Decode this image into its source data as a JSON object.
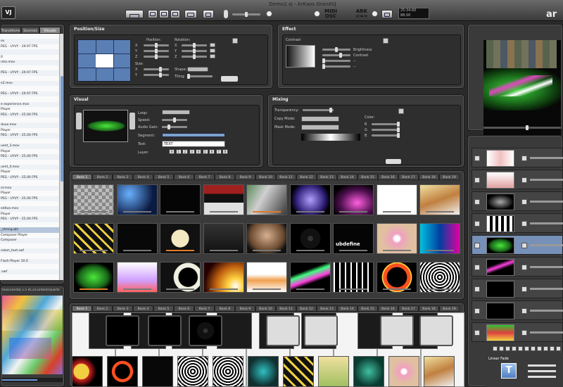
{
  "window": {
    "title": "Demo2.xj - ArKaos GrandVJ",
    "logo": "VJ",
    "brand_right": "ar"
  },
  "toolbar": {
    "midi_osc_line1": "MIDI",
    "midi_osc_line2": "OSC",
    "ark_line1": "ARK",
    "ark_line2": "<=>",
    "time_line1": "25:34:60",
    "time_line2": "88.00"
  },
  "left_tabs": [
    "Transitions",
    "Sources",
    "Visuals"
  ],
  "file_list": [
    "",
    "ov",
    "PEG - UYVY - 29.97 FPS",
    "",
    "0",
    "ntro.mov",
    "",
    "PEG - UYVY - 29.97 FPS",
    "",
    "e2.mov",
    "",
    "PEG - UYVY - 29.97 FPS",
    "",
    "e experience.mov",
    "Player",
    "PEG - UYVY - 25.00 FPS",
    "",
    "duuo.mov",
    "Player",
    "PEG - UYVY - 25.00 FPS",
    "",
    "uent_3.mov",
    "Player",
    "PEG - UYVY - 25.00 FPS",
    "",
    "uent_4.mov",
    "Player",
    "PEG - UYVY - 25.00 FPS",
    "",
    "ol.mov",
    "Player",
    "PEG - UYVY - 25.00 FPS",
    "",
    "ed4ue.mov",
    "Player",
    "PEG - UYVY - 25.00 FPS",
    "",
    "_strong.qtz",
    "Composer Player",
    "Composer",
    "",
    "ndom_text.swf",
    "",
    "Flash Player 10.0",
    "",
    ".swf",
    "",
    "Flash Player 10.0",
    ""
  ],
  "file_selected_index": 37,
  "source_path": "tos/GrandVJ 1.5 RC1/Content/Quartz",
  "position_panel": {
    "title": "Position/Size",
    "position": "Position:",
    "rotation": "Rotation:",
    "size": "Size:",
    "shape": "Shape:",
    "tiling": "Tiling:",
    "x": "X",
    "y": "Y",
    "z": "Z"
  },
  "effect_panel": {
    "title": "Effect",
    "contrast_title": "Contrast",
    "brightness": "Brightness",
    "contrast": "Contrast",
    "dash1": "--",
    "dash2": "--"
  },
  "visual_panel": {
    "title": "Visual",
    "loop": "Loop:",
    "speed": "Speed:",
    "audio_gain": "Audio Gain:",
    "segment": "Segment:",
    "text": "Text:",
    "layer": "Layer:",
    "text_value": "TEXT",
    "layers": [
      "0",
      "1",
      "2",
      "3",
      "4",
      "5",
      "6",
      "7",
      "8"
    ]
  },
  "mixing_panel": {
    "title": "Mixing",
    "transparency": "Transparency:",
    "copy_mode": "Copy Mode:",
    "mask_mode": "Mask Mode:",
    "color": "Color:",
    "r": "R",
    "g": "G",
    "b": "B"
  },
  "bank_top": {
    "tabs": [
      "Bank 1",
      "Bank 2",
      "Bank 3",
      "Bank 4",
      "Bank 5",
      "Bank 6",
      "Bank 7",
      "Bank 8",
      "Bank 9",
      "Bank 10",
      "Bank 11",
      "Bank 12",
      "Bank 13",
      "Bank 14",
      "Bank 15",
      "Bank 16",
      "Bank 17",
      "Bank 18",
      "Bank 19"
    ],
    "active": 0,
    "grid_text": "ubdefine"
  },
  "bank_bottom": {
    "tabs": [
      "Bank 1",
      "Bank 2",
      "Bank 3",
      "Bank 4",
      "Bank 5",
      "Bank 6",
      "Bank 7",
      "Bank 8",
      "Bank 9",
      "Bank 10",
      "Bank 11",
      "Bank 12",
      "Bank 13",
      "Bank 14",
      "Bank 15",
      "Bank 16",
      "Bank 17",
      "Bank 18",
      "Bank 19"
    ],
    "active": 0
  },
  "transition": {
    "label": "Linear Fade"
  },
  "colors": {
    "accent": "#e07a2a",
    "selection": "#7690b8"
  }
}
